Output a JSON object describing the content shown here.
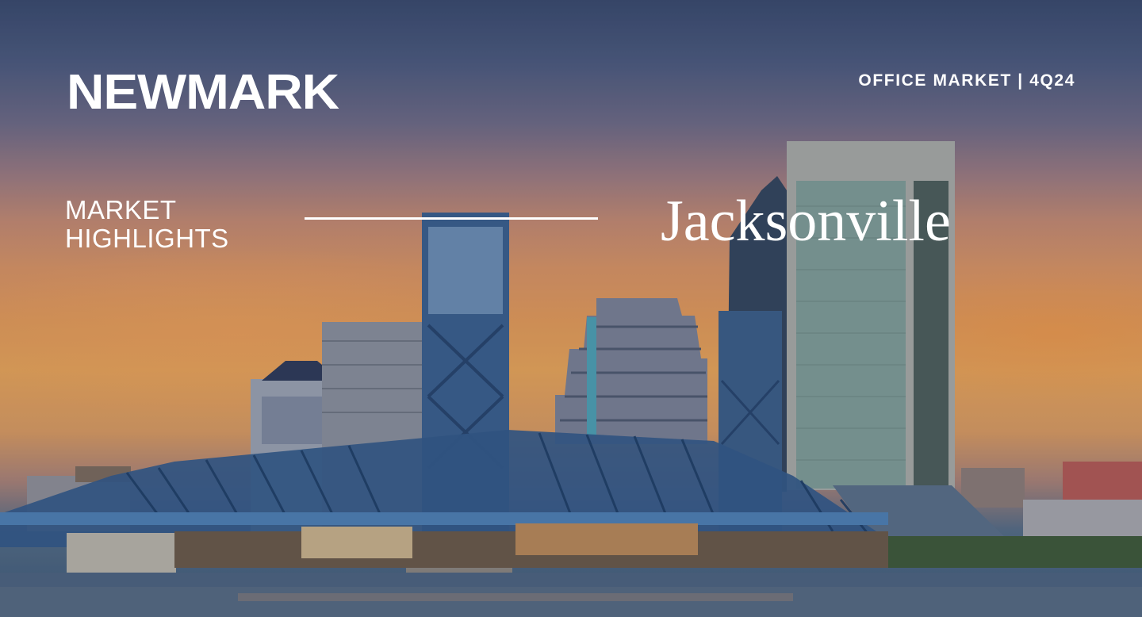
{
  "brand": {
    "logo_text": "NEWMARK"
  },
  "report": {
    "tag": "OFFICE MARKET | 4Q24"
  },
  "section": {
    "line1": "MARKET",
    "line2": "HIGHLIGHTS"
  },
  "market": {
    "city": "Jacksonville"
  },
  "colors": {
    "text": "#ffffff",
    "bridge": "#3f6fa8",
    "water": "#4d6480"
  },
  "background": {
    "image_subject": "jacksonville-skyline-photo"
  }
}
